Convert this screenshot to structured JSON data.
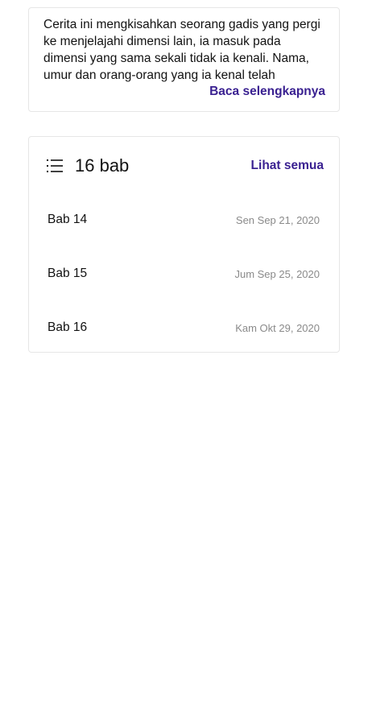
{
  "synopsis": {
    "text": "Cerita ini mengkisahkan seorang gadis yang pergi ke menjelajahi dimensi lain, ia masuk pada dimensi yang sama sekali tidak ia kenali. Nama, umur dan orang-orang yang ia kenal telah",
    "read_more_label": "Baca selengkapnya"
  },
  "chapters": {
    "icon": "list-icon",
    "count_label": "16 bab",
    "see_all_label": "Lihat semua",
    "items": [
      {
        "title": "Bab 14",
        "date": "Sen Sep 21, 2020"
      },
      {
        "title": "Bab 15",
        "date": "Jum Sep 25, 2020"
      },
      {
        "title": "Bab 16",
        "date": "Kam Okt 29, 2020"
      }
    ]
  },
  "colors": {
    "accent": "#3a2191",
    "text": "#121212",
    "muted": "#8a8a8a",
    "border": "#e6e6e6"
  }
}
